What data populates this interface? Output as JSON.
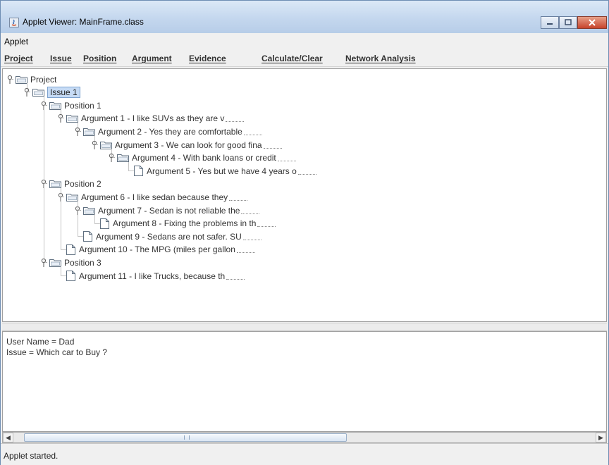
{
  "window": {
    "title": "Applet Viewer: MainFrame.class"
  },
  "applet_menu": {
    "label": "Applet"
  },
  "menu": [
    {
      "label": "Project",
      "name": "menu-project"
    },
    {
      "label": "Issue",
      "name": "menu-issue"
    },
    {
      "label": "Position",
      "name": "menu-position"
    },
    {
      "label": "Argument",
      "name": "menu-argument"
    },
    {
      "label": "Evidence",
      "name": "menu-evidence"
    },
    {
      "label": "Calculate/Clear",
      "name": "menu-calculate-clear"
    },
    {
      "label": "Network Analysis",
      "name": "menu-network-analysis"
    }
  ],
  "tree": {
    "nodes": [
      {
        "label": "Project",
        "type": "folder",
        "depth": 0,
        "expanded": true,
        "trailing_dots": false
      },
      {
        "label": "Issue 1",
        "type": "folder",
        "depth": 1,
        "expanded": true,
        "selected": true,
        "trailing_dots": false
      },
      {
        "label": "Position 1",
        "type": "folder",
        "depth": 2,
        "expanded": true,
        "trailing_dots": false
      },
      {
        "label": "Argument 1 - I like SUVs as they are v",
        "type": "folder",
        "depth": 3,
        "expanded": true,
        "trailing_dots": true
      },
      {
        "label": "Argument 2 - Yes they are comfortable",
        "type": "folder",
        "depth": 4,
        "expanded": true,
        "trailing_dots": true
      },
      {
        "label": "Argument 3 - We can look for good fina",
        "type": "folder",
        "depth": 5,
        "expanded": true,
        "trailing_dots": true
      },
      {
        "label": "Argument 4 - With bank loans or credit",
        "type": "folder",
        "depth": 6,
        "expanded": true,
        "trailing_dots": true
      },
      {
        "label": "Argument 5 - Yes but we have 4 years o",
        "type": "leaf",
        "depth": 7,
        "trailing_dots": true
      },
      {
        "label": "Position 2",
        "type": "folder",
        "depth": 2,
        "expanded": true,
        "trailing_dots": false
      },
      {
        "label": "Argument 6 - I like sedan because they",
        "type": "folder",
        "depth": 3,
        "expanded": true,
        "trailing_dots": true
      },
      {
        "label": "Argument 7 - Sedan is not reliable the",
        "type": "folder",
        "depth": 4,
        "expanded": true,
        "trailing_dots": true
      },
      {
        "label": "Argument 8 - Fixing the problems in th",
        "type": "leaf",
        "depth": 5,
        "trailing_dots": true
      },
      {
        "label": "Argument 9 - Sedans are not safer.  SU",
        "type": "leaf",
        "depth": 4,
        "trailing_dots": true
      },
      {
        "label": "Argument 10 - The MPG (miles per gallon",
        "type": "leaf",
        "depth": 3,
        "trailing_dots": true
      },
      {
        "label": "Position 3",
        "type": "folder",
        "depth": 2,
        "expanded": true,
        "trailing_dots": false
      },
      {
        "label": "Argument 11 - I like Trucks, because th",
        "type": "leaf",
        "depth": 3,
        "trailing_dots": true
      }
    ]
  },
  "info": {
    "user_line": "User Name = Dad",
    "issue_line": "Issue = Which car to Buy ?"
  },
  "scrollbar": {
    "left_arrow": "◀",
    "right_arrow": "▶"
  },
  "status": {
    "text": "Applet started."
  }
}
